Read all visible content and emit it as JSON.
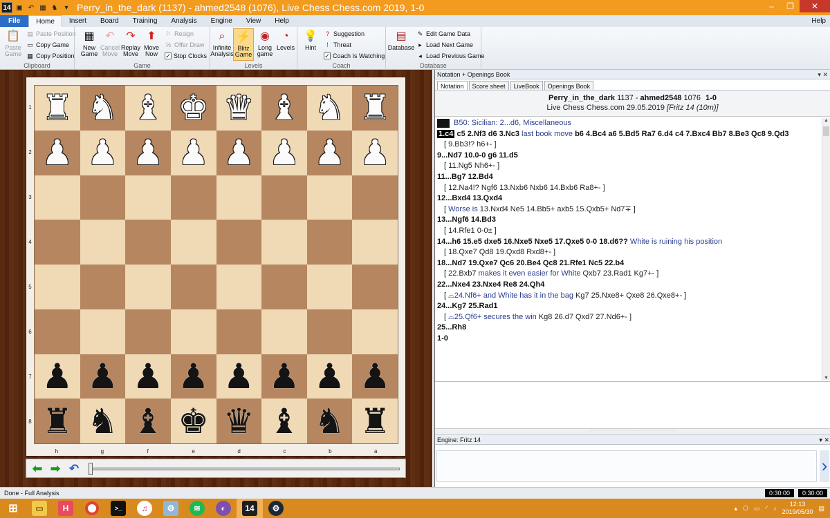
{
  "window": {
    "title": "Perry_in_the_dark (1137) - ahmed2548 (1076), Live Chess Chess.com 2019, 1-0",
    "app_badge": "14"
  },
  "ribbon_tabs": [
    "File",
    "Home",
    "Insert",
    "Board",
    "Training",
    "Analysis",
    "Engine",
    "View",
    "Help"
  ],
  "help_link": "Help",
  "ribbon": {
    "clipboard": {
      "paste_game": "Paste Game",
      "paste_position": "Paste Position",
      "copy_game": "Copy Game",
      "copy_position": "Copy Position",
      "label": "Clipboard"
    },
    "game": {
      "new_game": "New Game",
      "cancel_move": "Cancel Move",
      "replay_move": "Replay Move",
      "move_now": "Move Now",
      "resign": "Resign",
      "offer_draw": "Offer Draw",
      "stop_clocks": "Stop Clocks",
      "label": "Game"
    },
    "levels": {
      "infinite_analysis": "Infinite Analysis",
      "blitz_game": "Blitz Game",
      "long_game": "Long game",
      "levels": "Levels",
      "label": "Levels"
    },
    "coach": {
      "hint": "Hint",
      "suggestion": "Suggestion",
      "threat": "Threat",
      "coach_is_watching": "Coach Is Watching",
      "label": "Coach"
    },
    "database": {
      "database": "Database",
      "edit_game_data": "Edit Game Data",
      "load_next_game": "Load Next Game",
      "load_previous_game": "Load Previous Game",
      "label": "Database"
    }
  },
  "board": {
    "rank_labels": [
      "1",
      "2",
      "3",
      "4",
      "5",
      "6",
      "7",
      "8"
    ],
    "file_labels": [
      "h",
      "g",
      "f",
      "e",
      "d",
      "c",
      "b",
      "a"
    ],
    "rows": [
      [
        "wR",
        "wN",
        "wB",
        "wK",
        "wQ",
        "wB",
        "wN",
        "wR"
      ],
      [
        "wP",
        "wP",
        "wP",
        "wP",
        "wP",
        "wP",
        "wP",
        "wP"
      ],
      [
        "",
        "",
        "",
        "",
        "",
        "",
        "",
        ""
      ],
      [
        "",
        "",
        "",
        "",
        "",
        "",
        "",
        ""
      ],
      [
        "",
        "",
        "",
        "",
        "",
        "",
        "",
        ""
      ],
      [
        "",
        "",
        "",
        "",
        "",
        "",
        "",
        ""
      ],
      [
        "bP",
        "bP",
        "bP",
        "bP",
        "bP",
        "bP",
        "bP",
        "bP"
      ],
      [
        "bR",
        "bN",
        "bB",
        "bK",
        "bQ",
        "bB",
        "bN",
        "bR"
      ]
    ],
    "light_color": "#f0d9b5",
    "dark_color": "#b5865f"
  },
  "notation_pane": {
    "title": "Notation + Openings Book",
    "tabs": [
      "Notation",
      "Score sheet",
      "LiveBook",
      "Openings Book"
    ],
    "header_line1": {
      "white": "Perry_in_the_dark",
      "white_elo": "1137",
      "sep": "-",
      "black": "ahmed2548",
      "black_elo": "1076",
      "result": "1-0"
    },
    "header_line2": {
      "event": "Live Chess Chess.com 29.05.2019",
      "annotator": "[Fritz 14 (10m)]"
    },
    "eco": "B50: Sicilian: 2...d6, Miscellaneous",
    "lines": [
      {
        "indent": false,
        "parts": [
          {
            "t": "1.c4",
            "c": "cur"
          },
          {
            "t": " c5  2.Nf3  d6  3.Nc3 ",
            "c": "m"
          },
          {
            "t": "last book move",
            "c": "cm"
          },
          {
            "t": "  b6  4.Bc4  a6  5.Bd5  Ra7  6.d4  c4  7.Bxc4  Bb7  8.Be3  Qc8  9.Qd3",
            "c": "m"
          }
        ]
      },
      {
        "indent": true,
        "parts": [
          {
            "t": "[ 9.Bb3!?  h6+- ]",
            "c": "v"
          }
        ]
      },
      {
        "indent": false,
        "parts": [
          {
            "t": "9...Nd7  10.0-0  g6  11.d5",
            "c": "m"
          }
        ]
      },
      {
        "indent": true,
        "parts": [
          {
            "t": "[ 11.Ng5  Nh6+- ]",
            "c": "v"
          }
        ]
      },
      {
        "indent": false,
        "parts": [
          {
            "t": "11...Bg7  12.Bd4",
            "c": "m"
          }
        ]
      },
      {
        "indent": true,
        "parts": [
          {
            "t": "[ 12.Na4!?  Ngf6  13.Nxb6  Nxb6  14.Bxb6  Ra8+- ]",
            "c": "v"
          }
        ]
      },
      {
        "indent": false,
        "parts": [
          {
            "t": "12...Bxd4  13.Qxd4",
            "c": "m"
          }
        ]
      },
      {
        "indent": true,
        "parts": [
          {
            "t": "[ ",
            "c": "v"
          },
          {
            "t": "Worse is",
            "c": "cm"
          },
          {
            "t": " 13.Nxd4  Ne5  14.Bb5+  axb5  15.Qxb5+  Nd7∓ ]",
            "c": "v"
          }
        ]
      },
      {
        "indent": false,
        "parts": [
          {
            "t": "13...Ngf6  14.Bd3",
            "c": "m"
          }
        ]
      },
      {
        "indent": true,
        "parts": [
          {
            "t": "[ 14.Rfe1  0-0± ]",
            "c": "v"
          }
        ]
      },
      {
        "indent": false,
        "parts": [
          {
            "t": "14...h6  15.e5  dxe5  16.Nxe5  Nxe5  17.Qxe5  0-0  18.d6?? ",
            "c": "m"
          },
          {
            "t": "White is ruining his position",
            "c": "cm"
          }
        ]
      },
      {
        "indent": true,
        "parts": [
          {
            "t": "[ 18.Qxe7  Qd8  19.Qxd8  Rxd8+- ]",
            "c": "v"
          }
        ]
      },
      {
        "indent": false,
        "parts": [
          {
            "t": "18...Nd7  19.Qxe7  Qc6  20.Be4  Qc8  21.Rfe1  Nc5  22.b4",
            "c": "m"
          }
        ]
      },
      {
        "indent": true,
        "parts": [
          {
            "t": "[ 22.Bxb7 ",
            "c": "v"
          },
          {
            "t": "makes it even easier for White",
            "c": "cm"
          },
          {
            "t": "  Qxb7  23.Rad1  Kg7+- ]",
            "c": "v"
          }
        ]
      },
      {
        "indent": false,
        "parts": [
          {
            "t": "22...Nxe4  23.Nxe4  Re8  24.Qh4",
            "c": "m"
          }
        ]
      },
      {
        "indent": true,
        "parts": [
          {
            "t": "[ ",
            "c": "v"
          },
          {
            "t": "⌓24.Nf6+ and White has it in the bag",
            "c": "cm"
          },
          {
            "t": "  Kg7  25.Nxe8+  Qxe8  26.Qxe8+- ]",
            "c": "v"
          }
        ]
      },
      {
        "indent": false,
        "parts": [
          {
            "t": "24...Kg7  25.Rad1",
            "c": "m"
          }
        ]
      },
      {
        "indent": true,
        "parts": [
          {
            "t": "[ ",
            "c": "v"
          },
          {
            "t": "⌓25.Qf6+ secures the win",
            "c": "cm"
          },
          {
            "t": "  Kg8  26.d7  Qxd7  27.Nd6+- ]",
            "c": "v"
          }
        ]
      },
      {
        "indent": false,
        "parts": [
          {
            "t": "25...Rh8",
            "c": "m"
          }
        ]
      },
      {
        "indent": false,
        "parts": [
          {
            "t": "1-0",
            "c": "m"
          }
        ]
      }
    ]
  },
  "engine_pane": {
    "title": "Engine: Fritz 14"
  },
  "status": {
    "text": "Done - Full Analysis",
    "white_clock": "0:30:00",
    "black_clock": "0:30:00"
  },
  "taskbar": {
    "time": "12:13",
    "date": "2019/05/30",
    "apps": [
      "windows",
      "file-explorer",
      "h-app",
      "chrome",
      "terminal",
      "itunes",
      "network-tool",
      "spotify",
      "chess-app",
      "fritz-14",
      "steam"
    ]
  }
}
